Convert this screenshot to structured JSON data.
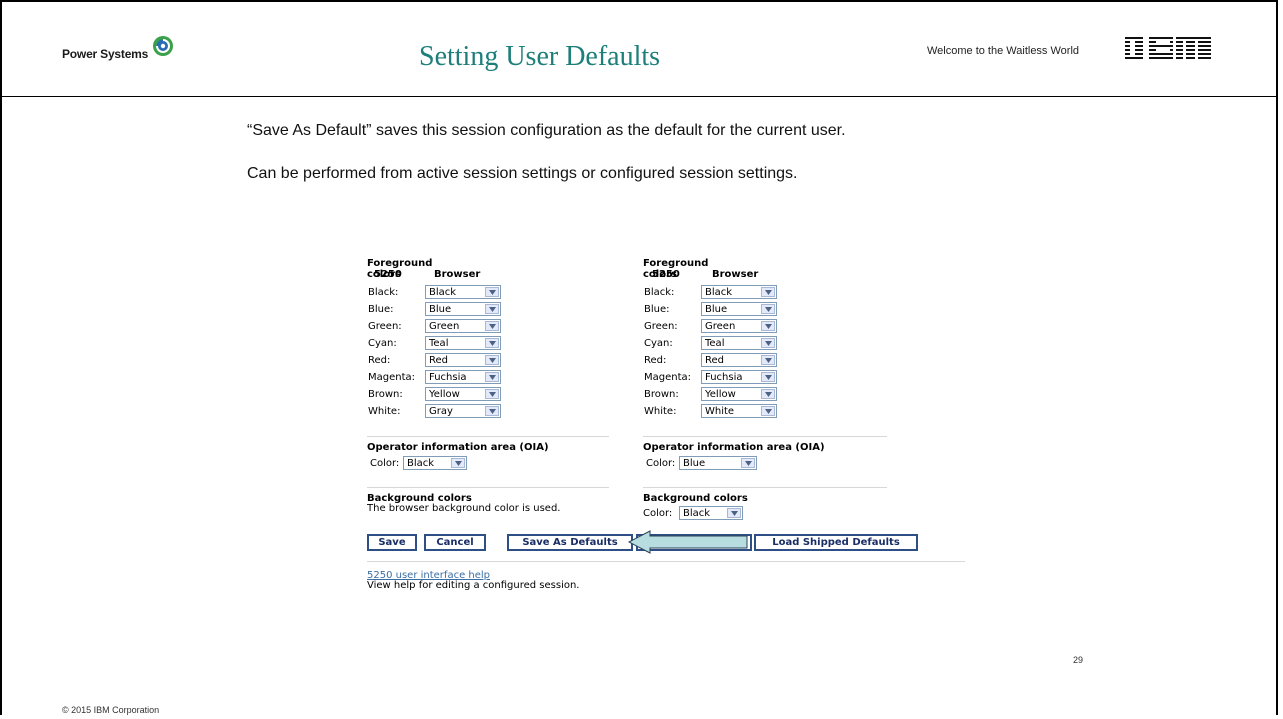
{
  "header": {
    "brand": "Power Systems",
    "title": "Setting User Defaults",
    "tagline": "Welcome to the Waitless World",
    "logo": "IBM"
  },
  "bullets": [
    "“Save As Default” saves this session configuration as the default for the current user.",
    "Can be performed from active session settings or configured session settings."
  ],
  "left_panel": {
    "fg_title": "Foreground colors",
    "col_5250": "5250",
    "col_browser": "Browser",
    "rows": [
      {
        "label": "Black:",
        "value": "Black"
      },
      {
        "label": "Blue:",
        "value": "Blue"
      },
      {
        "label": "Green:",
        "value": "Green"
      },
      {
        "label": "Cyan:",
        "value": "Teal"
      },
      {
        "label": "Red:",
        "value": "Red"
      },
      {
        "label": "Magenta:",
        "value": "Fuchsia"
      },
      {
        "label": "Brown:",
        "value": "Yellow"
      },
      {
        "label": "White:",
        "value": "Gray"
      }
    ],
    "oia_title": "Operator information area (OIA)",
    "oia_label": "Color:",
    "oia_value": "Black",
    "bg_title": "Background colors",
    "bg_note": "The browser background color is used."
  },
  "right_panel": {
    "fg_title": "Foreground colors",
    "col_5250": "5250",
    "col_browser": "Browser",
    "rows": [
      {
        "label": "Black:",
        "value": "Black"
      },
      {
        "label": "Blue:",
        "value": "Blue"
      },
      {
        "label": "Green:",
        "value": "Green"
      },
      {
        "label": "Cyan:",
        "value": "Teal"
      },
      {
        "label": "Red:",
        "value": "Red"
      },
      {
        "label": "Magenta:",
        "value": "Fuchsia"
      },
      {
        "label": "Brown:",
        "value": "Yellow"
      },
      {
        "label": "White:",
        "value": "White"
      }
    ],
    "oia_title": "Operator information area (OIA)",
    "oia_label": "Color:",
    "oia_value": "Blue",
    "bg_title": "Background colors",
    "bg_label": "Color:",
    "bg_value": "Black"
  },
  "buttons": {
    "save": "Save",
    "cancel": "Cancel",
    "save_as_defaults": "Save As Defaults",
    "load_defaults_partial": "faults",
    "load_shipped_defaults": "Load Shipped Defaults"
  },
  "help": {
    "link": "5250 user interface help",
    "text": "View help for editing a configured session."
  },
  "footer": {
    "copyright": "© 2015 IBM Corporation",
    "page_number": "29"
  },
  "colors": {
    "title": "#1d7e7a",
    "button_border": "#2d4f86",
    "callout_fill": "#b7dde0",
    "link": "#3a6ea5"
  },
  "icons": {
    "brand_logo": "power-systems-logo",
    "dropdown": "chevron-down-icon",
    "callout": "arrow-left-callout"
  }
}
